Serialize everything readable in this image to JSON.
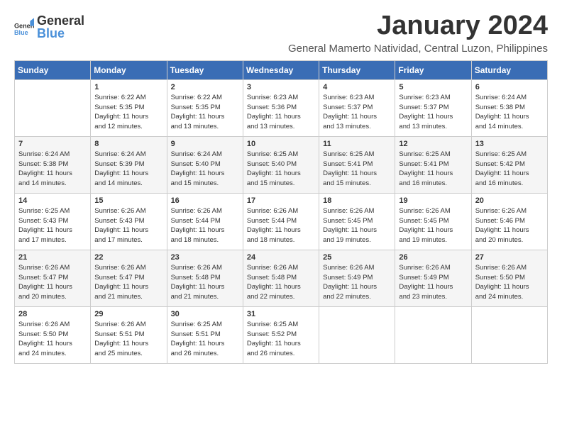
{
  "logo": {
    "general": "General",
    "blue": "Blue"
  },
  "title": "January 2024",
  "location": "General Mamerto Natividad, Central Luzon, Philippines",
  "weekdays": [
    "Sunday",
    "Monday",
    "Tuesday",
    "Wednesday",
    "Thursday",
    "Friday",
    "Saturday"
  ],
  "weeks": [
    [
      {
        "day": "",
        "info": ""
      },
      {
        "day": "1",
        "info": "Sunrise: 6:22 AM\nSunset: 5:35 PM\nDaylight: 11 hours\nand 12 minutes."
      },
      {
        "day": "2",
        "info": "Sunrise: 6:22 AM\nSunset: 5:35 PM\nDaylight: 11 hours\nand 13 minutes."
      },
      {
        "day": "3",
        "info": "Sunrise: 6:23 AM\nSunset: 5:36 PM\nDaylight: 11 hours\nand 13 minutes."
      },
      {
        "day": "4",
        "info": "Sunrise: 6:23 AM\nSunset: 5:37 PM\nDaylight: 11 hours\nand 13 minutes."
      },
      {
        "day": "5",
        "info": "Sunrise: 6:23 AM\nSunset: 5:37 PM\nDaylight: 11 hours\nand 13 minutes."
      },
      {
        "day": "6",
        "info": "Sunrise: 6:24 AM\nSunset: 5:38 PM\nDaylight: 11 hours\nand 14 minutes."
      }
    ],
    [
      {
        "day": "7",
        "info": "Sunrise: 6:24 AM\nSunset: 5:38 PM\nDaylight: 11 hours\nand 14 minutes."
      },
      {
        "day": "8",
        "info": "Sunrise: 6:24 AM\nSunset: 5:39 PM\nDaylight: 11 hours\nand 14 minutes."
      },
      {
        "day": "9",
        "info": "Sunrise: 6:24 AM\nSunset: 5:40 PM\nDaylight: 11 hours\nand 15 minutes."
      },
      {
        "day": "10",
        "info": "Sunrise: 6:25 AM\nSunset: 5:40 PM\nDaylight: 11 hours\nand 15 minutes."
      },
      {
        "day": "11",
        "info": "Sunrise: 6:25 AM\nSunset: 5:41 PM\nDaylight: 11 hours\nand 15 minutes."
      },
      {
        "day": "12",
        "info": "Sunrise: 6:25 AM\nSunset: 5:41 PM\nDaylight: 11 hours\nand 16 minutes."
      },
      {
        "day": "13",
        "info": "Sunrise: 6:25 AM\nSunset: 5:42 PM\nDaylight: 11 hours\nand 16 minutes."
      }
    ],
    [
      {
        "day": "14",
        "info": "Sunrise: 6:25 AM\nSunset: 5:43 PM\nDaylight: 11 hours\nand 17 minutes."
      },
      {
        "day": "15",
        "info": "Sunrise: 6:26 AM\nSunset: 5:43 PM\nDaylight: 11 hours\nand 17 minutes."
      },
      {
        "day": "16",
        "info": "Sunrise: 6:26 AM\nSunset: 5:44 PM\nDaylight: 11 hours\nand 18 minutes."
      },
      {
        "day": "17",
        "info": "Sunrise: 6:26 AM\nSunset: 5:44 PM\nDaylight: 11 hours\nand 18 minutes."
      },
      {
        "day": "18",
        "info": "Sunrise: 6:26 AM\nSunset: 5:45 PM\nDaylight: 11 hours\nand 19 minutes."
      },
      {
        "day": "19",
        "info": "Sunrise: 6:26 AM\nSunset: 5:45 PM\nDaylight: 11 hours\nand 19 minutes."
      },
      {
        "day": "20",
        "info": "Sunrise: 6:26 AM\nSunset: 5:46 PM\nDaylight: 11 hours\nand 20 minutes."
      }
    ],
    [
      {
        "day": "21",
        "info": "Sunrise: 6:26 AM\nSunset: 5:47 PM\nDaylight: 11 hours\nand 20 minutes."
      },
      {
        "day": "22",
        "info": "Sunrise: 6:26 AM\nSunset: 5:47 PM\nDaylight: 11 hours\nand 21 minutes."
      },
      {
        "day": "23",
        "info": "Sunrise: 6:26 AM\nSunset: 5:48 PM\nDaylight: 11 hours\nand 21 minutes."
      },
      {
        "day": "24",
        "info": "Sunrise: 6:26 AM\nSunset: 5:48 PM\nDaylight: 11 hours\nand 22 minutes."
      },
      {
        "day": "25",
        "info": "Sunrise: 6:26 AM\nSunset: 5:49 PM\nDaylight: 11 hours\nand 22 minutes."
      },
      {
        "day": "26",
        "info": "Sunrise: 6:26 AM\nSunset: 5:49 PM\nDaylight: 11 hours\nand 23 minutes."
      },
      {
        "day": "27",
        "info": "Sunrise: 6:26 AM\nSunset: 5:50 PM\nDaylight: 11 hours\nand 24 minutes."
      }
    ],
    [
      {
        "day": "28",
        "info": "Sunrise: 6:26 AM\nSunset: 5:50 PM\nDaylight: 11 hours\nand 24 minutes."
      },
      {
        "day": "29",
        "info": "Sunrise: 6:26 AM\nSunset: 5:51 PM\nDaylight: 11 hours\nand 25 minutes."
      },
      {
        "day": "30",
        "info": "Sunrise: 6:25 AM\nSunset: 5:51 PM\nDaylight: 11 hours\nand 26 minutes."
      },
      {
        "day": "31",
        "info": "Sunrise: 6:25 AM\nSunset: 5:52 PM\nDaylight: 11 hours\nand 26 minutes."
      },
      {
        "day": "",
        "info": ""
      },
      {
        "day": "",
        "info": ""
      },
      {
        "day": "",
        "info": ""
      }
    ]
  ]
}
